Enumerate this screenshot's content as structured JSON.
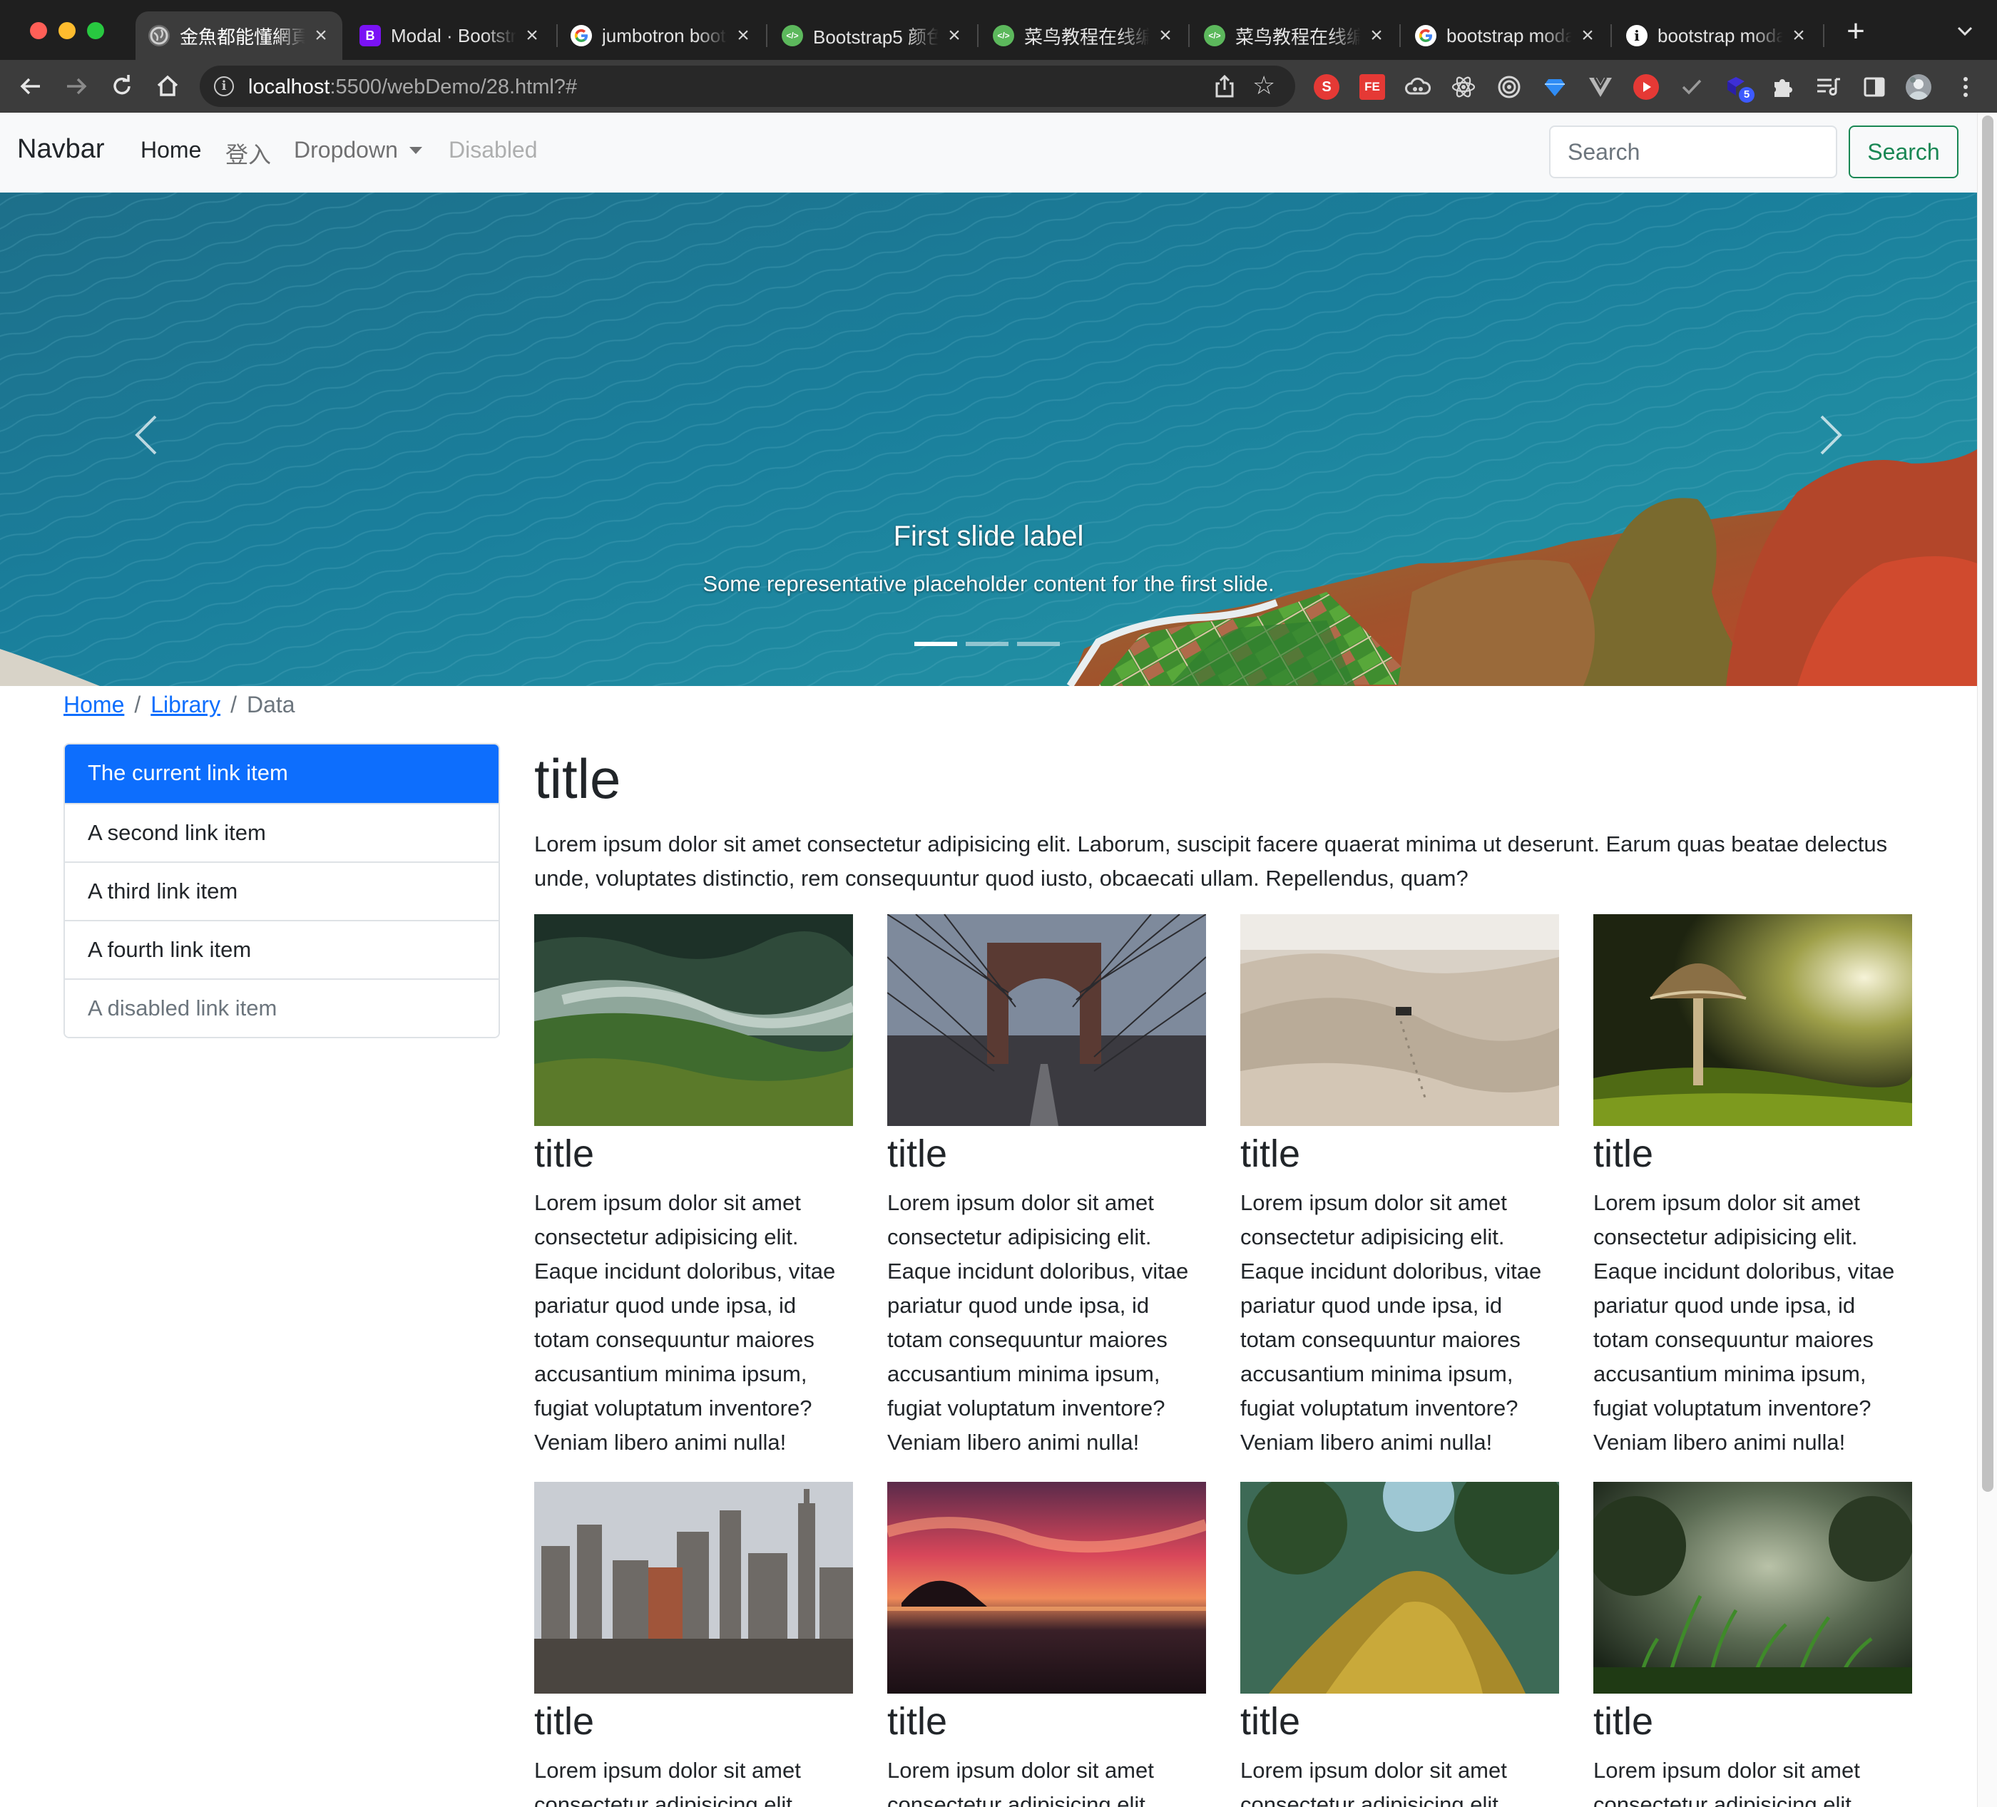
{
  "browser": {
    "tabs": [
      {
        "title": "金魚都能懂網頁",
        "icon": "globe-icon",
        "active": true
      },
      {
        "title": "Modal · Bootstrap",
        "icon": "bootstrap-icon"
      },
      {
        "title": "jumbotron bootstrap",
        "icon": "google-icon"
      },
      {
        "title": "Bootstrap5 颜色",
        "icon": "runoob-icon"
      },
      {
        "title": "菜鸟教程在线编辑器",
        "icon": "runoob-icon"
      },
      {
        "title": "菜鸟教程在线编辑器",
        "icon": "runoob-icon"
      },
      {
        "title": "bootstrap modal",
        "icon": "google-icon"
      },
      {
        "title": "bootstrap modal",
        "icon": "page-icon"
      }
    ],
    "url_host": "localhost",
    "url_rest": ":5500/webDemo/28.html?#",
    "extension_badge": "5",
    "colors": {
      "tabbar": "#1f1f1f",
      "toolbar": "#3c3c3c"
    }
  },
  "navbar": {
    "brand": "Navbar",
    "links": [
      "Home",
      "登入",
      "Dropdown",
      "Disabled"
    ],
    "search_placeholder": "Search",
    "search_button": "Search"
  },
  "carousel": {
    "caption_title": "First slide label",
    "caption_text": "Some representative placeholder content for the first slide.",
    "indicator_count": 3,
    "active_indicator": 0
  },
  "breadcrumb": {
    "items": [
      "Home",
      "Library"
    ],
    "current": "Data"
  },
  "list_group": {
    "items": [
      "The current link item",
      "A second link item",
      "A third link item",
      "A fourth link item",
      "A disabled link item"
    ]
  },
  "main": {
    "title": "title",
    "text": "Lorem ipsum dolor sit amet consectetur adipisicing elit. Laborum, suscipit facere quaerat minima ut deserunt. Earum quas beatae delectus unde, voluptates distinctio, rem consequuntur quod iusto, obcaecati ullam. Repellendus, quam?"
  },
  "cards": [
    {
      "title": "title",
      "text": "Lorem ipsum dolor sit amet consectetur adipisicing elit. Eaque incidunt doloribus, vitae pariatur quod unde ipsa, id totam consequuntur maiores accusantium minima ipsum, fugiat voluptatum inventore? Veniam libero animi nulla!"
    },
    {
      "title": "title",
      "text": "Lorem ipsum dolor sit amet consectetur adipisicing elit. Eaque incidunt doloribus, vitae pariatur quod unde ipsa, id totam consequuntur maiores accusantium minima ipsum, fugiat voluptatum inventore? Veniam libero animi nulla!"
    },
    {
      "title": "title",
      "text": "Lorem ipsum dolor sit amet consectetur adipisicing elit. Eaque incidunt doloribus, vitae pariatur quod unde ipsa, id totam consequuntur maiores accusantium minima ipsum, fugiat voluptatum inventore? Veniam libero animi nulla!"
    },
    {
      "title": "title",
      "text": "Lorem ipsum dolor sit amet consectetur adipisicing elit. Eaque incidunt doloribus, vitae pariatur quod unde ipsa, id totam consequuntur maiores accusantium minima ipsum, fugiat voluptatum inventore? Veniam libero animi nulla!"
    },
    {
      "title": "title",
      "text": "Lorem ipsum dolor sit amet consectetur adipisicing elit."
    },
    {
      "title": "title",
      "text": "Lorem ipsum dolor sit amet consectetur adipisicing elit."
    },
    {
      "title": "title",
      "text": "Lorem ipsum dolor sit amet consectetur adipisicing elit."
    },
    {
      "title": "title",
      "text": "Lorem ipsum dolor sit amet consectetur adipisicing elit."
    }
  ],
  "theme": {
    "primary": "#0d6efd",
    "success": "#198754",
    "muted": "#6c757d",
    "border": "#dee2e6",
    "navbar_bg": "#f8f9fa"
  }
}
